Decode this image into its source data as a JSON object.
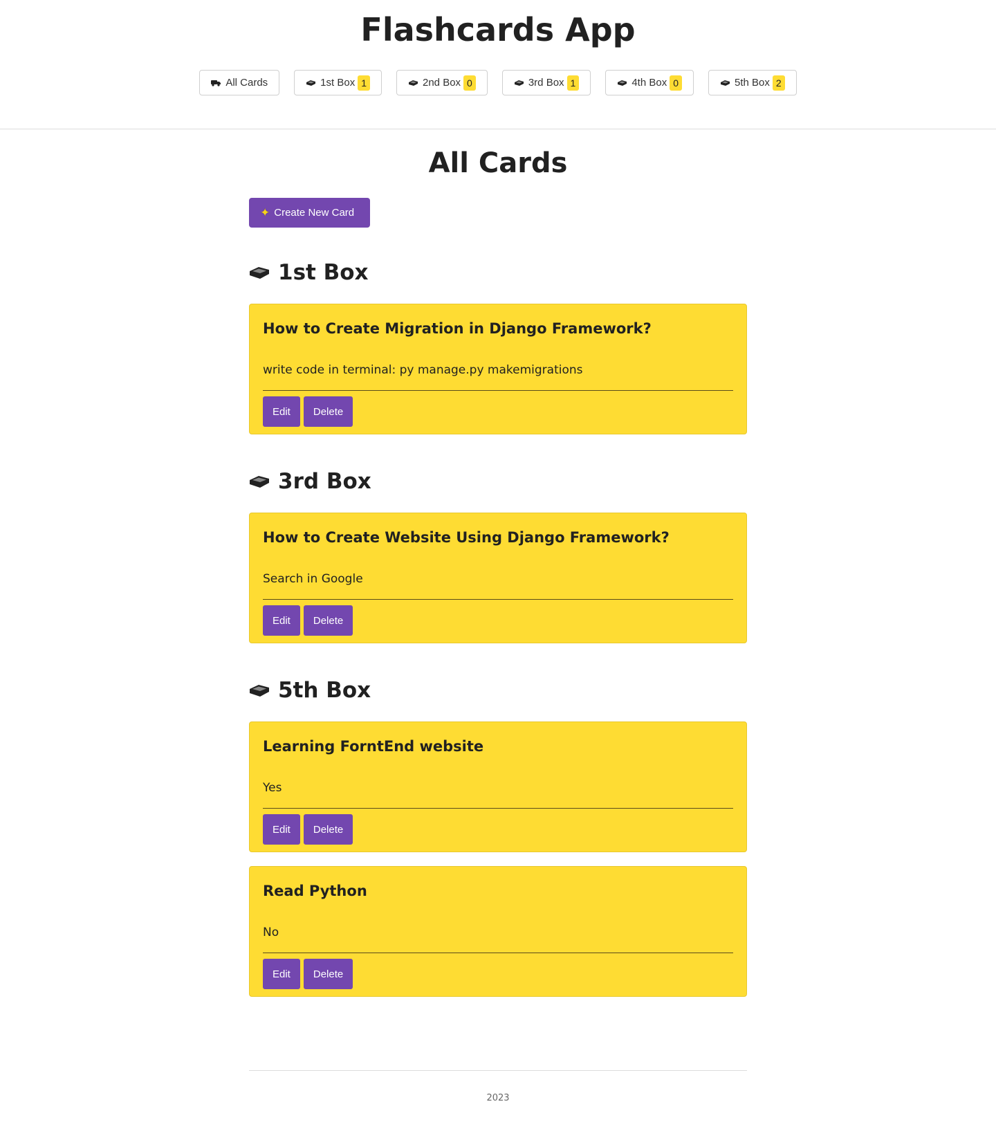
{
  "app": {
    "title": "Flashcards App"
  },
  "nav": {
    "items": [
      {
        "label": "All Cards",
        "icon": "truck-icon",
        "count": null
      },
      {
        "label": "1st Box",
        "icon": "box-icon",
        "count": "1"
      },
      {
        "label": "2nd Box",
        "icon": "box-icon",
        "count": "0"
      },
      {
        "label": "3rd Box",
        "icon": "box-icon",
        "count": "1"
      },
      {
        "label": "4th Box",
        "icon": "box-icon",
        "count": "0"
      },
      {
        "label": "5th Box",
        "icon": "box-icon",
        "count": "2"
      }
    ]
  },
  "main": {
    "title": "All Cards",
    "create_label": "Create New Card"
  },
  "sections": [
    {
      "title": "1st Box",
      "cards": [
        {
          "question": "How to Create Migration in Django Framework?",
          "answer": "write code in terminal: py manage.py makemigrations"
        }
      ]
    },
    {
      "title": "3rd Box",
      "cards": [
        {
          "question": "How to Create Website Using Django Framework?",
          "answer": "Search in Google"
        }
      ]
    },
    {
      "title": "5th Box",
      "cards": [
        {
          "question": "Learning ForntEnd website",
          "answer": "Yes"
        },
        {
          "question": "Read Python",
          "answer": "No"
        }
      ]
    }
  ],
  "card_actions": {
    "edit_label": "Edit",
    "delete_label": "Delete"
  },
  "footer": {
    "year": "2023"
  },
  "colors": {
    "accent": "#7347af",
    "card": "#fedc33",
    "badge": "#fedc33"
  }
}
